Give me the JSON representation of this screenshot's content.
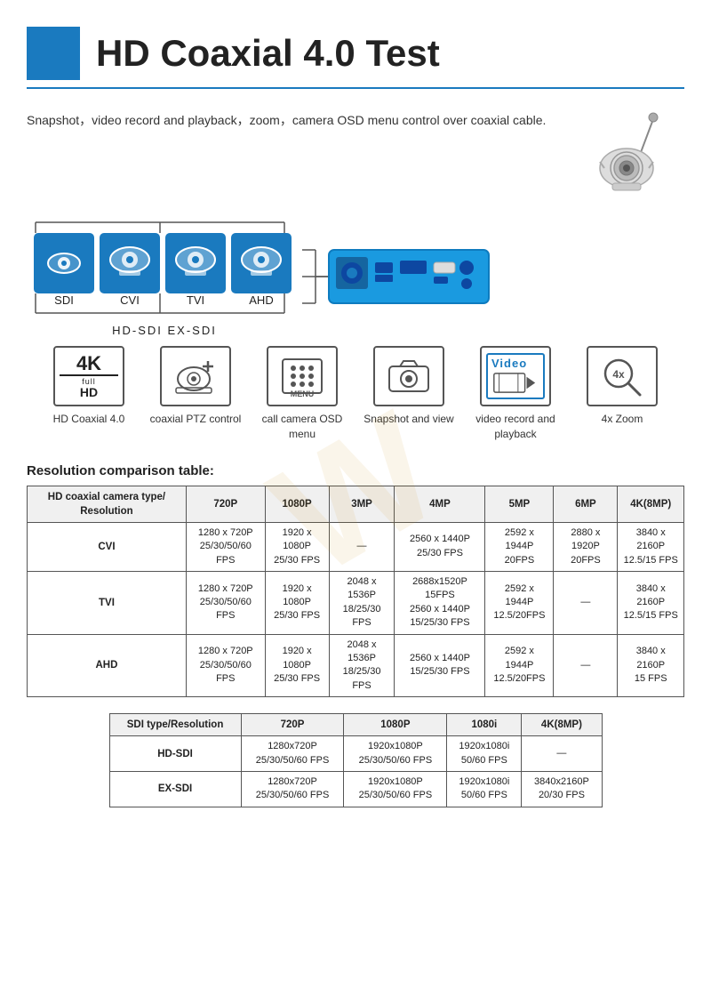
{
  "header": {
    "title": "HD Coaxial 4.0 Test"
  },
  "intro": {
    "text": "Snapshot，video record and playback，zoom，camera OSD menu control over coaxial cable."
  },
  "camera_types": [
    {
      "label": "SDI",
      "type": "eye"
    },
    {
      "label": "CVI",
      "type": "dome1"
    },
    {
      "label": "TVI",
      "type": "dome2"
    },
    {
      "label": "AHD",
      "type": "dome3"
    }
  ],
  "hd_sdi_label": "HD-SDI  EX-SDI",
  "features": [
    {
      "label": "HD Coaxial 4.0",
      "icon": "4k"
    },
    {
      "label": "coaxial PTZ control",
      "icon": "ptz"
    },
    {
      "label": "call camera OSD menu",
      "icon": "menu"
    },
    {
      "label": "Snapshot and view",
      "icon": "snapshot"
    },
    {
      "label": "video record and playback",
      "icon": "video"
    },
    {
      "label": "4x Zoom",
      "icon": "zoom"
    }
  ],
  "resolution_title": "Resolution comparison table:",
  "main_table": {
    "header": [
      "HD coaxial camera type/ Resolution",
      "720P",
      "1080P",
      "3MP",
      "4MP",
      "5MP",
      "6MP",
      "4K(8MP)"
    ],
    "rows": [
      {
        "label": "CVI",
        "cells": [
          "1280 x 720P\n25/30/50/60 FPS",
          "1920 x 1080P\n25/30 FPS",
          "—",
          "2560 x 1440P\n25/30 FPS",
          "2592 x 1944P\n20FPS",
          "2880 x 1920P\n20FPS",
          "3840 x 2160P\n12.5/15 FPS"
        ]
      },
      {
        "label": "TVI",
        "cells": [
          "1280 x 720P\n25/30/50/60 FPS",
          "1920 x 1080P\n25/30 FPS",
          "2048 x 1536P\n18/25/30 FPS",
          "2688x1520P 15FPS\n2560 x 1440P\n15/25/30 FPS",
          "2592 x 1944P\n12.5/20FPS",
          "—",
          "3840 x 2160P\n12.5/15 FPS"
        ]
      },
      {
        "label": "AHD",
        "cells": [
          "1280 x 720P\n25/30/50/60 FPS",
          "1920 x 1080P\n25/30 FPS",
          "2048 x 1536P\n18/25/30 FPS",
          "2560 x 1440P\n15/25/30 FPS",
          "2592 x 1944P\n12.5/20FPS",
          "—",
          "3840 x 2160P\n15 FPS"
        ]
      }
    ]
  },
  "sdi_table": {
    "header": [
      "SDI type/Resolution",
      "720P",
      "1080P",
      "1080i",
      "4K(8MP)"
    ],
    "rows": [
      {
        "label": "HD-SDI",
        "cells": [
          "1280x720P\n25/30/50/60 FPS",
          "1920x1080P\n25/30/50/60 FPS",
          "1920x1080i\n50/60 FPS",
          "—"
        ]
      },
      {
        "label": "EX-SDI",
        "cells": [
          "1280x720P\n25/30/50/60 FPS",
          "1920x1080P\n25/30/50/60 FPS",
          "1920x1080i\n50/60 FPS",
          "3840x2160P\n20/30 FPS"
        ]
      }
    ]
  }
}
